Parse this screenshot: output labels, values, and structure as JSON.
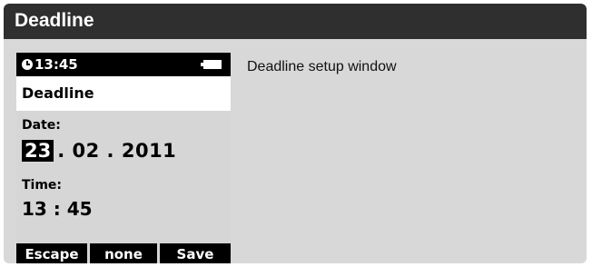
{
  "window": {
    "title": "Deadline"
  },
  "device": {
    "status": {
      "time": "13:45",
      "clock_icon": "clock-icon",
      "battery_icon": "battery-icon"
    },
    "header": "Deadline",
    "date": {
      "label": "Date:",
      "day": "23",
      "rest": ". 02 . 2011"
    },
    "time": {
      "label": "Time:",
      "value": "13 : 45"
    },
    "softkeys": {
      "left": "Escape",
      "middle": "none",
      "right": "Save"
    }
  },
  "description": "Deadline setup window"
}
